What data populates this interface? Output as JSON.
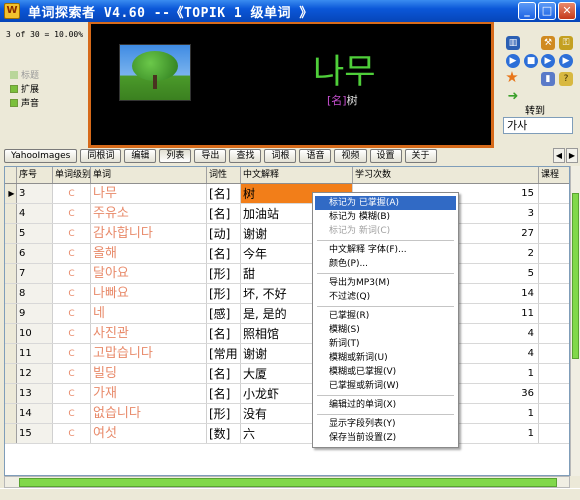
{
  "window": {
    "title": "单词探索者 V4.60 --《TOPIK 1 级单词 》",
    "app_icon": "dictionary-app-icon"
  },
  "status": {
    "progress_text": "3 of 30 = 10.00%"
  },
  "options": [
    {
      "label": "标题",
      "checked": false,
      "disabled": true
    },
    {
      "label": "扩展",
      "checked": true,
      "disabled": false
    },
    {
      "label": "声音",
      "checked": true,
      "disabled": false
    }
  ],
  "display": {
    "word": "나무",
    "pos_tag": "[名]",
    "meaning": "树"
  },
  "side_tools": {
    "goto_label": "转到",
    "goto_value": "가사",
    "icons": [
      "book-icon",
      "tools-icon",
      "lock-icon",
      "play-icon",
      "stop-icon",
      "next-icon",
      "star-icon",
      "chart-icon",
      "help-icon",
      "arrow-right-icon"
    ]
  },
  "toolbar": {
    "buttons": [
      "YahooImages",
      "同根词",
      "编辑",
      "列表",
      "导出",
      "查找",
      "词根",
      "语音",
      "视频",
      "设置",
      "关于"
    ],
    "active": "列表"
  },
  "grid": {
    "headers": [
      "序号",
      "单词级别",
      "单词",
      "词性",
      "中文解释",
      "学习次数",
      "课程"
    ],
    "rows": [
      {
        "no": "3",
        "level": "C",
        "word": "나무",
        "pos": "[名]",
        "meaning": "树",
        "count": "15"
      },
      {
        "no": "4",
        "level": "C",
        "word": "주유소",
        "pos": "[名]",
        "meaning": "加油站",
        "count": "3"
      },
      {
        "no": "5",
        "level": "C",
        "word": "감사합니다",
        "pos": "[动]",
        "meaning": "谢谢",
        "count": "27"
      },
      {
        "no": "6",
        "level": "C",
        "word": "올해",
        "pos": "[名]",
        "meaning": "今年",
        "count": "2"
      },
      {
        "no": "7",
        "level": "C",
        "word": "달아요",
        "pos": "[形]",
        "meaning": "甜",
        "count": "5"
      },
      {
        "no": "8",
        "level": "C",
        "word": "나빠요",
        "pos": "[形]",
        "meaning": "坏, 不好",
        "count": "14"
      },
      {
        "no": "9",
        "level": "C",
        "word": "네",
        "pos": "[感]",
        "meaning": "是, 是的",
        "count": "11"
      },
      {
        "no": "10",
        "level": "C",
        "word": "사진관",
        "pos": "[名]",
        "meaning": "照相馆",
        "count": "4"
      },
      {
        "no": "11",
        "level": "C",
        "word": "고맙습니다",
        "pos": "[常用",
        "meaning": "谢谢",
        "count": "4"
      },
      {
        "no": "12",
        "level": "C",
        "word": "빌딩",
        "pos": "[名]",
        "meaning": "大厦",
        "count": "1"
      },
      {
        "no": "13",
        "level": "C",
        "word": "가재",
        "pos": "[名]",
        "meaning": "小龙虾",
        "count": "36"
      },
      {
        "no": "14",
        "level": "C",
        "word": "없습니다",
        "pos": "[形]",
        "meaning": "没有",
        "count": "1"
      },
      {
        "no": "15",
        "level": "C",
        "word": "여섯",
        "pos": "[数]",
        "meaning": "六",
        "count": "1"
      }
    ],
    "current_row_indicator": "▶"
  },
  "context_menu": {
    "items": [
      {
        "label": "标记为 已掌握(A)",
        "highlighted": true,
        "disabled": false
      },
      {
        "label": "标记为 模糊(B)",
        "highlighted": false,
        "disabled": false
      },
      {
        "label": "标记为 新词(C)",
        "highlighted": false,
        "disabled": true
      },
      {
        "sep": true
      },
      {
        "label": "中文解释 字体(F)...",
        "highlighted": false,
        "disabled": false
      },
      {
        "label": "颜色(P)...",
        "highlighted": false,
        "disabled": false
      },
      {
        "sep": true
      },
      {
        "label": "导出为MP3(M)",
        "highlighted": false,
        "disabled": false
      },
      {
        "label": "不过滤(Q)",
        "highlighted": false,
        "disabled": false
      },
      {
        "sep": true
      },
      {
        "label": "已掌握(R)",
        "highlighted": false,
        "disabled": false
      },
      {
        "label": "模糊(S)",
        "highlighted": false,
        "disabled": false
      },
      {
        "label": "新词(T)",
        "highlighted": false,
        "disabled": false
      },
      {
        "label": "模糊或新词(U)",
        "highlighted": false,
        "disabled": false
      },
      {
        "label": "模糊或已掌握(V)",
        "highlighted": false,
        "disabled": false
      },
      {
        "label": "已掌握或新词(W)",
        "highlighted": false,
        "disabled": false
      },
      {
        "sep": true
      },
      {
        "label": "编辑过的单词(X)",
        "highlighted": false,
        "disabled": false
      },
      {
        "sep": true
      },
      {
        "label": "显示字段列表(Y)",
        "highlighted": false,
        "disabled": false
      },
      {
        "label": "保存当前设置(Z)",
        "highlighted": false,
        "disabled": false
      }
    ]
  },
  "colors": {
    "title_bar": "#0b57d8",
    "display_border": "#d66a1a",
    "word_green": "#4fcf3a",
    "korean_text": "#e88a6a",
    "selected_cell": "#f27e19",
    "menu_highlight": "#316ac5",
    "scroll_thumb": "#81d84a"
  }
}
